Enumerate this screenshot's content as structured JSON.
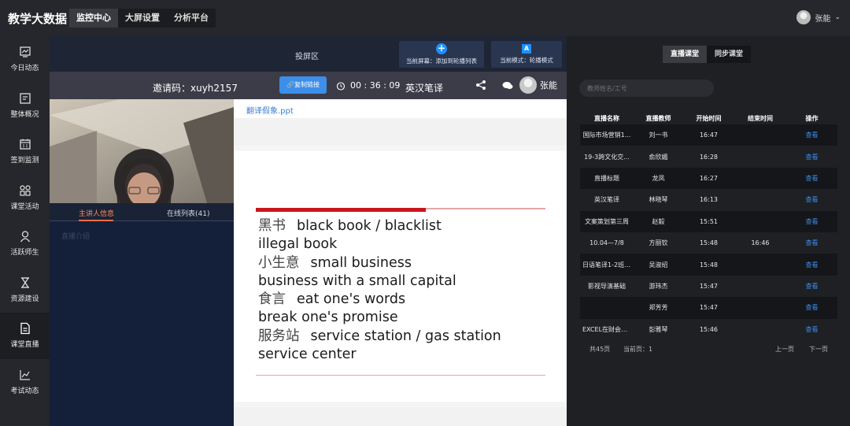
{
  "app": {
    "title": "教学大数据",
    "nav": [
      "监控中心",
      "大屏设置",
      "分析平台"
    ],
    "user": "张能"
  },
  "sidebar": {
    "items": [
      {
        "label": "今日动态",
        "icon": "monitor-icon"
      },
      {
        "label": "整体概况",
        "icon": "overview-icon"
      },
      {
        "label": "签到监测",
        "icon": "calendar-icon"
      },
      {
        "label": "课堂活动",
        "icon": "grid-icon"
      },
      {
        "label": "活跃师生",
        "icon": "person-icon"
      },
      {
        "label": "资源建设",
        "icon": "hourglass-icon"
      },
      {
        "label": "课堂直播",
        "icon": "document-icon"
      },
      {
        "label": "考试动态",
        "icon": "line-chart-icon"
      }
    ],
    "active": "课堂直播"
  },
  "projection": {
    "title": "投屏区",
    "btn_add": "当前屏幕：添加到轮播列表",
    "btn_mode": "当前模式：轮播模式",
    "mode_icon_letter": "A"
  },
  "session": {
    "invite": "邀请码：xuyh2157",
    "copy": "复制链接",
    "timer": "00 : 36 : 09",
    "course": "英汉笔译",
    "host": "张能"
  },
  "left_panel": {
    "tabs": [
      "主讲人信息",
      "在线列表(41)"
    ],
    "intro": "直播介绍"
  },
  "document": {
    "filename": "翻译假象.ppt",
    "lines": [
      {
        "zh": "黑书",
        "en": "black book / blacklist"
      },
      {
        "zh": "",
        "en": "illegal book"
      },
      {
        "zh": "小生意",
        "en": "small business"
      },
      {
        "zh": "",
        "en": "business with a small capital"
      },
      {
        "zh": "食言",
        "en": "eat one's words"
      },
      {
        "zh": "",
        "en": "break one's promise"
      },
      {
        "zh": "服务站",
        "en": "service station / gas station"
      },
      {
        "zh": "",
        "en": "service center"
      }
    ]
  },
  "live": {
    "tabs": [
      "直播课堂",
      "同步课堂"
    ],
    "search_placeholder": "教师姓名/工号",
    "columns": [
      "直播名称",
      "直播教师",
      "开始时间",
      "结束时间",
      "操作"
    ],
    "rows": [
      {
        "name": "国际市场营销1...",
        "teacher": "刘一书",
        "start": "16:47",
        "end": "",
        "action": "查看"
      },
      {
        "name": "19-3跨文化交...",
        "teacher": "俞欣媚",
        "start": "16:28",
        "end": "",
        "action": "查看"
      },
      {
        "name": "直播标题",
        "teacher": "龙凤",
        "start": "16:27",
        "end": "",
        "action": "查看"
      },
      {
        "name": "英汉笔译",
        "teacher": "林晓琴",
        "start": "16:13",
        "end": "",
        "action": "查看"
      },
      {
        "name": "文案策划第三周",
        "teacher": "赵毅",
        "start": "15:51",
        "end": "",
        "action": "查看"
      },
      {
        "name": "10.04—7/8",
        "teacher": "方丽钦",
        "start": "15:48",
        "end": "16:46",
        "action": "查看"
      },
      {
        "name": "日语笔译1-2班 ...",
        "teacher": "吴淑绍",
        "start": "15:48",
        "end": "",
        "action": "查看"
      },
      {
        "name": "影视导演基础",
        "teacher": "游玮杰",
        "start": "15:47",
        "end": "",
        "action": "查看"
      },
      {
        "name": "",
        "teacher": "郑芳芳",
        "start": "15:47",
        "end": "",
        "action": "查看"
      },
      {
        "name": "EXCEL在财会中...",
        "teacher": "彭雅琴",
        "start": "15:46",
        "end": "",
        "action": "查看"
      }
    ],
    "pager": {
      "total": "共45页",
      "current": "当前页：1",
      "prev": "上一页",
      "next": "下一页"
    }
  }
}
